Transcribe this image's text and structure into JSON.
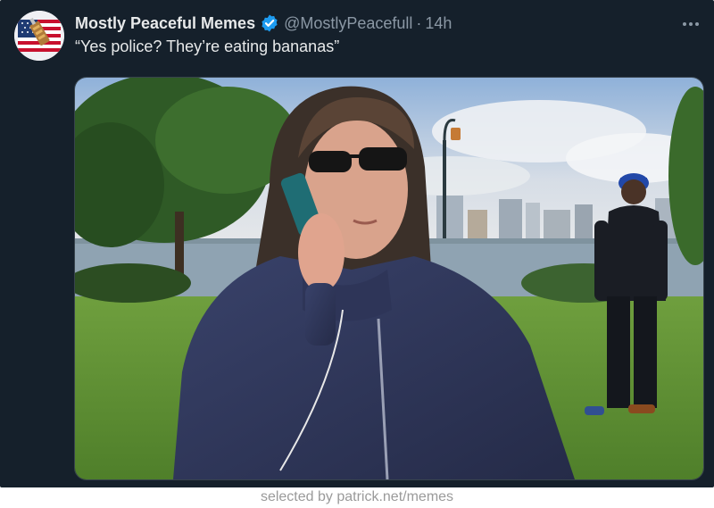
{
  "tweet": {
    "display_name": "Mostly Peaceful Memes",
    "handle": "@MostlyPeacefull",
    "separator": "·",
    "time": "14h",
    "text": "“Yes police? They’re eating bananas”",
    "more_icon": "more-horizontal-icon",
    "verified_icon": "verified-badge-icon"
  },
  "caption": "selected by patrick.net/memes",
  "colors": {
    "background": "#15202b",
    "text": "#e7e9ea",
    "muted": "#8b98a5",
    "verified": "#1d9bf0"
  }
}
